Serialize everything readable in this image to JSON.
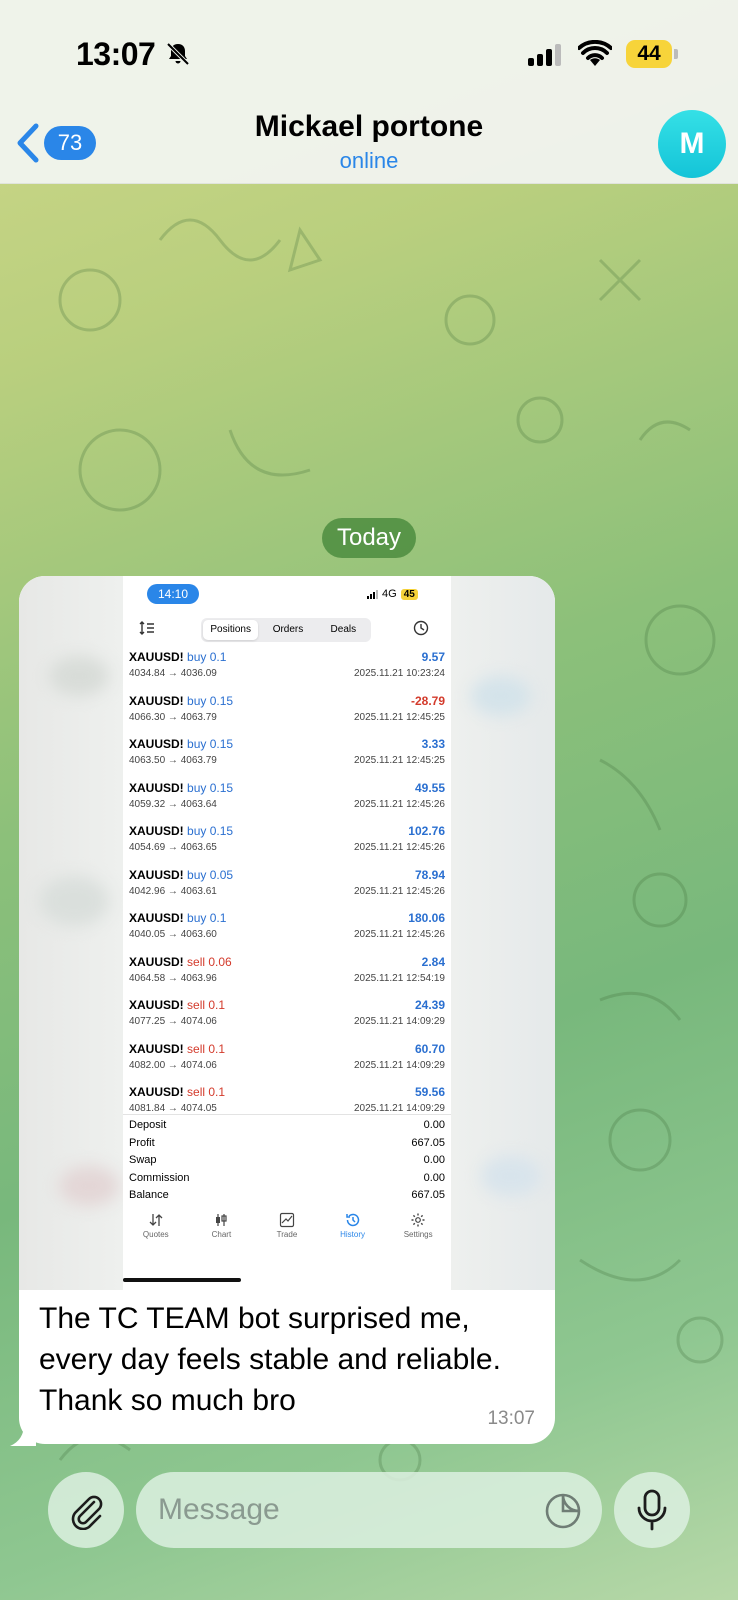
{
  "status_bar": {
    "time": "13:07",
    "battery": "44"
  },
  "header": {
    "unread_count": "73",
    "title": "Mickael portone",
    "status": "online",
    "avatar_letter": "M"
  },
  "chat": {
    "day_label": "Today"
  },
  "message": {
    "text_lines": [
      "The TC TEAM bot surprised me,",
      "every day feels stable and reliable.",
      "Thank so much bro"
    ],
    "time": "13:07",
    "screenshot": {
      "status_time": "14:10",
      "network": "4G",
      "battery": "45",
      "tabs": [
        "Positions",
        "Orders",
        "Deals"
      ],
      "active_tab": "Positions",
      "positions": [
        {
          "symbol": "XAUUSD!",
          "side": "buy 0.1",
          "prices": "4034.84 → 4036.09",
          "profit": "9.57",
          "date": "2025.11.21 10:23:24"
        },
        {
          "symbol": "XAUUSD!",
          "side": "buy 0.15",
          "prices": "4066.30 → 4063.79",
          "profit": "-28.79",
          "date": "2025.11.21 12:45:25"
        },
        {
          "symbol": "XAUUSD!",
          "side": "buy 0.15",
          "prices": "4063.50 → 4063.79",
          "profit": "3.33",
          "date": "2025.11.21 12:45:25"
        },
        {
          "symbol": "XAUUSD!",
          "side": "buy 0.15",
          "prices": "4059.32 → 4063.64",
          "profit": "49.55",
          "date": "2025.11.21 12:45:26"
        },
        {
          "symbol": "XAUUSD!",
          "side": "buy 0.15",
          "prices": "4054.69 → 4063.65",
          "profit": "102.76",
          "date": "2025.11.21 12:45:26"
        },
        {
          "symbol": "XAUUSD!",
          "side": "buy 0.05",
          "prices": "4042.96 → 4063.61",
          "profit": "78.94",
          "date": "2025.11.21 12:45:26"
        },
        {
          "symbol": "XAUUSD!",
          "side": "buy 0.1",
          "prices": "4040.05 → 4063.60",
          "profit": "180.06",
          "date": "2025.11.21 12:45:26"
        },
        {
          "symbol": "XAUUSD!",
          "side": "sell 0.06",
          "prices": "4064.58 → 4063.96",
          "profit": "2.84",
          "date": "2025.11.21 12:54:19"
        },
        {
          "symbol": "XAUUSD!",
          "side": "sell 0.1",
          "prices": "4077.25 → 4074.06",
          "profit": "24.39",
          "date": "2025.11.21 14:09:29"
        },
        {
          "symbol": "XAUUSD!",
          "side": "sell 0.1",
          "prices": "4082.00 → 4074.06",
          "profit": "60.70",
          "date": "2025.11.21 14:09:29"
        },
        {
          "symbol": "XAUUSD!",
          "side": "sell 0.1",
          "prices": "4081.84 → 4074.05",
          "profit": "59.56",
          "date": "2025.11.21 14:09:29"
        }
      ],
      "summary": [
        {
          "label": "Deposit",
          "value": "0.00"
        },
        {
          "label": "Profit",
          "value": "667.05"
        },
        {
          "label": "Swap",
          "value": "0.00"
        },
        {
          "label": "Commission",
          "value": "0.00"
        },
        {
          "label": "Balance",
          "value": "667.05"
        }
      ],
      "nav": [
        "Quotes",
        "Chart",
        "Trade",
        "History",
        "Settings"
      ],
      "active_nav": "History"
    }
  },
  "input": {
    "placeholder": "Message"
  },
  "colors": {
    "accent": "#2a86e8",
    "buy": "#2a6fd0",
    "sell": "#d33a2b",
    "day_pill": "#4c8c40",
    "battery": "#f7d43a"
  }
}
